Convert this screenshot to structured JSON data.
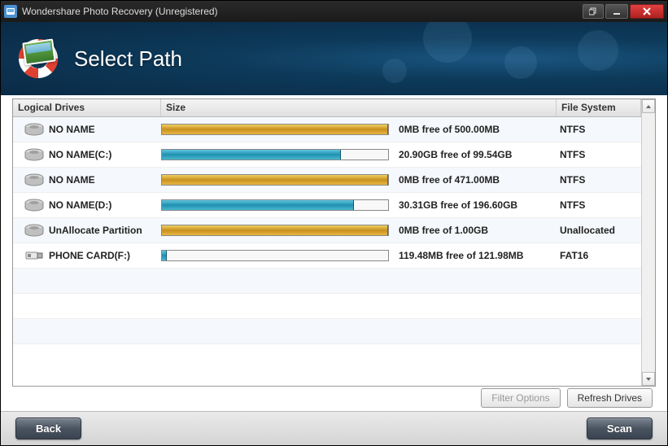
{
  "titlebar": {
    "title": "Wondershare Photo Recovery (Unregistered)"
  },
  "header": {
    "title": "Select Path"
  },
  "table": {
    "headers": [
      "Logical Drives",
      "Size",
      "File System"
    ],
    "rows": [
      {
        "name": "NO NAME",
        "icon": "hdd",
        "fill": 100,
        "color": "gold",
        "free_text": "0MB free of 500.00MB",
        "fs": "NTFS"
      },
      {
        "name": "NO NAME(C:)",
        "icon": "hdd",
        "fill": 79,
        "color": "teal",
        "free_text": "20.90GB free of 99.54GB",
        "fs": "NTFS"
      },
      {
        "name": "NO NAME",
        "icon": "hdd",
        "fill": 100,
        "color": "gold",
        "free_text": "0MB free of 471.00MB",
        "fs": "NTFS"
      },
      {
        "name": "NO NAME(D:)",
        "icon": "hdd",
        "fill": 85,
        "color": "teal",
        "free_text": "30.31GB free of 196.60GB",
        "fs": "NTFS"
      },
      {
        "name": "UnAllocate Partition",
        "icon": "hdd",
        "fill": 100,
        "color": "gold",
        "free_text": "0MB free of 1.00GB",
        "fs": "Unallocated"
      },
      {
        "name": "PHONE CARD(F:)",
        "icon": "usb",
        "fill": 2,
        "color": "teal",
        "free_text": "119.48MB free of 121.98MB",
        "fs": "FAT16"
      }
    ]
  },
  "buttons": {
    "filter": "Filter Options",
    "refresh": "Refresh Drives",
    "back": "Back",
    "scan": "Scan"
  }
}
